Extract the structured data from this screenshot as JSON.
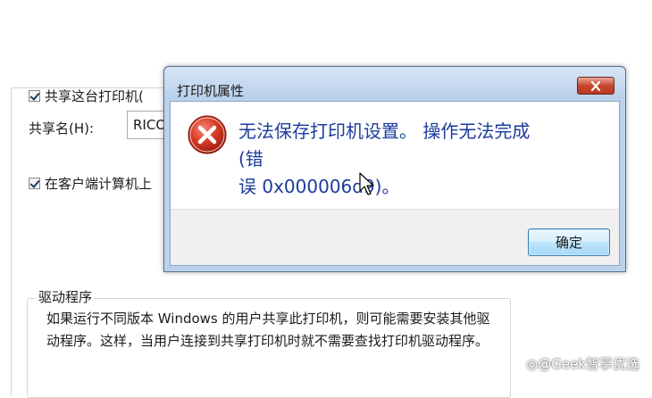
{
  "background": {
    "share_checkbox_label": "共享这台打印机(",
    "share_name_label": "共享名(H):",
    "share_name_value": "RICO",
    "render_checkbox_label": "在客户端计算机上",
    "drivers_group_title": "驱动程序",
    "drivers_text": "如果运行不同版本 Windows 的用户共享此打印机，则可能需要安装其他驱动程序。这样，当用户连接到共享打印机时就不需要查找打印机驱动程序。"
  },
  "dialog": {
    "title": "打印机属性",
    "icon": "error-icon",
    "message_line1": "无法保存打印机设置。 操作无法完成(错",
    "message_line2": "误 0x000006d9)。",
    "ok_label": "确定",
    "close_button_color": "#c8452c"
  },
  "watermark": "◎@Geek智享优选"
}
